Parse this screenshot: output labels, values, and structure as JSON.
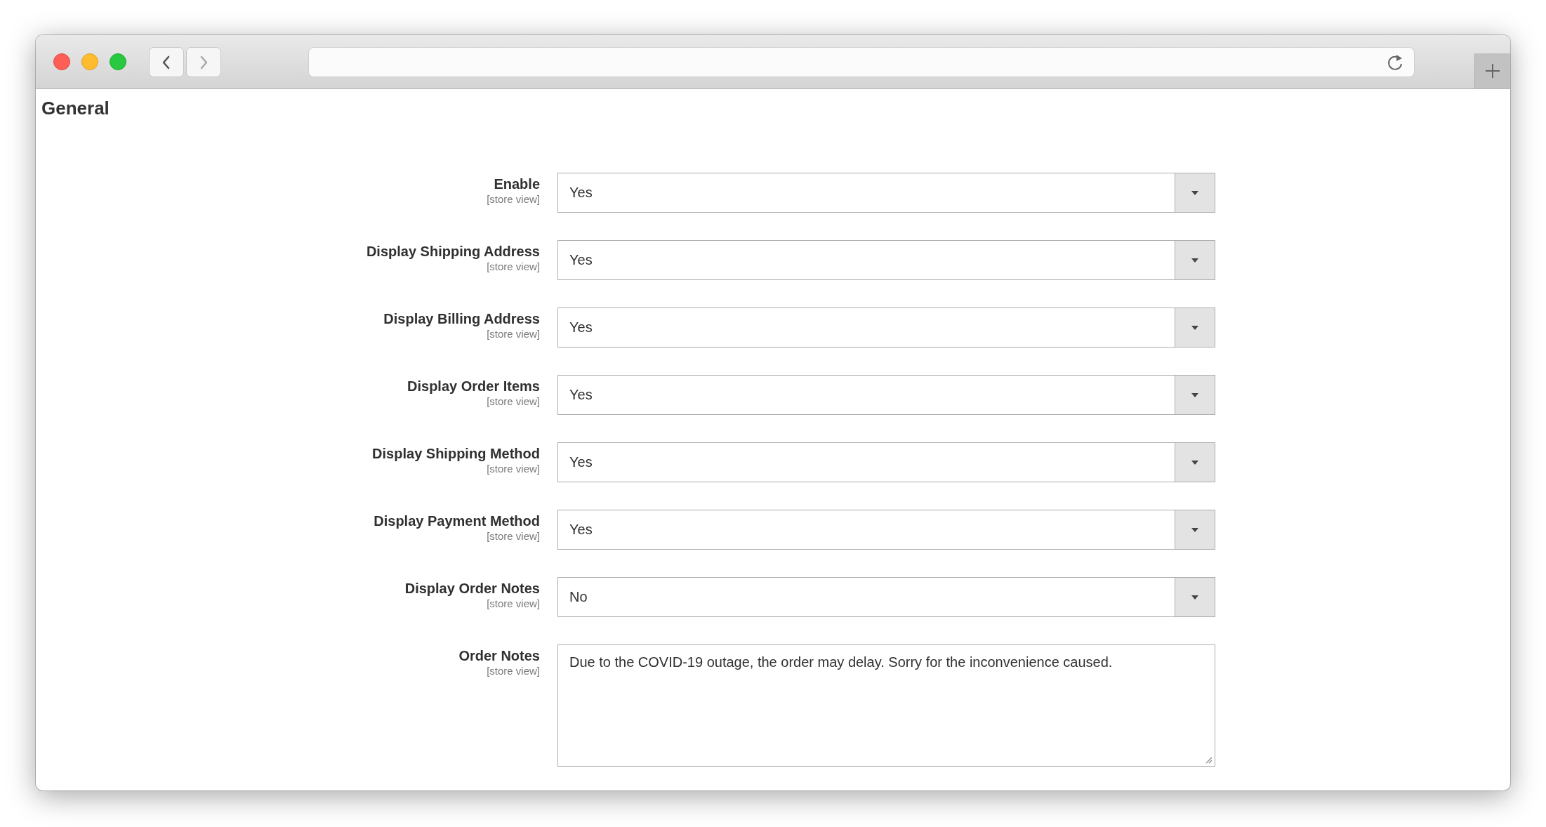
{
  "browser": {
    "back_enabled": true,
    "forward_enabled": false
  },
  "page": {
    "title": "General"
  },
  "fields": [
    {
      "kind": "select",
      "label": "Enable",
      "scope": "[store view]",
      "value": "Yes"
    },
    {
      "kind": "select",
      "label": "Display Shipping Address",
      "scope": "[store view]",
      "value": "Yes"
    },
    {
      "kind": "select",
      "label": "Display Billing Address",
      "scope": "[store view]",
      "value": "Yes"
    },
    {
      "kind": "select",
      "label": "Display Order Items",
      "scope": "[store view]",
      "value": "Yes"
    },
    {
      "kind": "select",
      "label": "Display Shipping Method",
      "scope": "[store view]",
      "value": "Yes"
    },
    {
      "kind": "select",
      "label": "Display Payment Method",
      "scope": "[store view]",
      "value": "Yes"
    },
    {
      "kind": "select",
      "label": "Display Order Notes",
      "scope": "[store view]",
      "value": "No"
    },
    {
      "kind": "textarea",
      "label": "Order Notes",
      "scope": "[store view]",
      "value": "Due to the COVID-19 outage, the order may delay. Sorry for the inconvenience caused."
    }
  ]
}
